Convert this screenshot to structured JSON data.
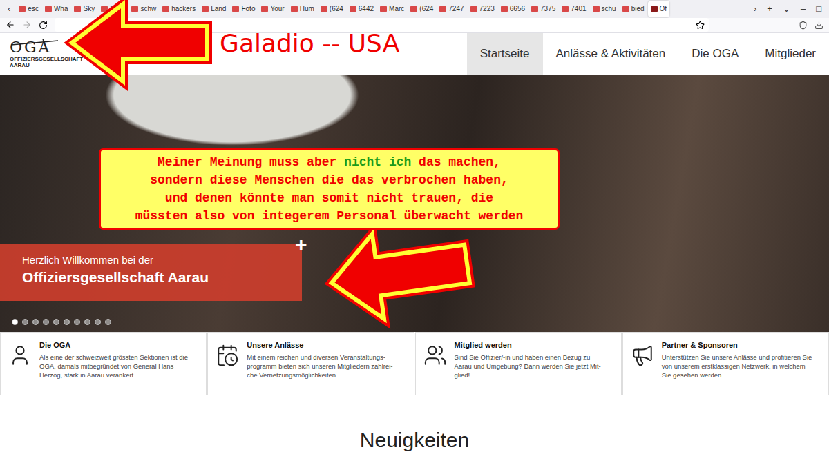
{
  "browser": {
    "scroll_left": "‹",
    "tabs": [
      {
        "label": "esc",
        "selected": false
      },
      {
        "label": "Wha",
        "selected": false
      },
      {
        "label": "Sky",
        "selected": false
      },
      {
        "label": "Marc",
        "selected": false
      },
      {
        "label": "schw",
        "selected": false
      },
      {
        "label": "hackers",
        "selected": false
      },
      {
        "label": "Land",
        "selected": false
      },
      {
        "label": "Foto",
        "selected": false
      },
      {
        "label": "Your",
        "selected": false
      },
      {
        "label": "Hum",
        "selected": false
      },
      {
        "label": "(624",
        "selected": false
      },
      {
        "label": "6442",
        "selected": false
      },
      {
        "label": "Marc",
        "selected": false
      },
      {
        "label": "(624",
        "selected": false
      },
      {
        "label": "7247",
        "selected": false
      },
      {
        "label": "7223",
        "selected": false
      },
      {
        "label": "6656",
        "selected": false
      },
      {
        "label": "7375",
        "selected": false
      },
      {
        "label": "7401",
        "selected": false
      },
      {
        "label": "schu",
        "selected": false
      },
      {
        "label": "bied",
        "selected": false
      },
      {
        "label": "Of",
        "selected": true
      }
    ],
    "controls": [
      "›",
      "+",
      "⌄",
      "–",
      "□"
    ]
  },
  "site": {
    "logo": {
      "mark": "OGA",
      "name_lines": [
        "OFFIZIERSGESELLSCHAFT",
        "AARAU"
      ]
    },
    "nav": [
      {
        "label": "Startseite",
        "selected": true
      },
      {
        "label": "Anlässe & Aktivitäten",
        "selected": false
      },
      {
        "label": "Die OGA",
        "selected": false
      },
      {
        "label": "Mitglieder",
        "selected": false
      }
    ]
  },
  "hero": {
    "banner_lines": [
      "Herzlich Willkommen bei der",
      "Offiziersgesellschaft Aarau"
    ],
    "plus": "+",
    "dots": [
      {
        "selected": true
      },
      {
        "selected": false
      },
      {
        "selected": false
      },
      {
        "selected": false
      },
      {
        "selected": false
      },
      {
        "selected": false
      },
      {
        "selected": false
      },
      {
        "selected": false
      },
      {
        "selected": false
      },
      {
        "selected": false
      }
    ]
  },
  "cards": [
    {
      "kind": "soldier",
      "title": "Die OGA",
      "lines": [
        "Als eine der schweizweit grössten Sektionen ist die",
        "OGA, damals mitbegründet von General Hans",
        "Herzog, stark in Aarau verankert."
      ]
    },
    {
      "kind": "calendar",
      "title": "Unsere Anlässe",
      "lines": [
        "Mit einem reichen und diversen Veranstaltungs-",
        "programm bieten sich unseren Mitgliedern zahlrei-",
        "che Vernetzungsmöglichkeiten."
      ]
    },
    {
      "kind": "members",
      "title": "Mitglied werden",
      "lines": [
        "Sind Sie Offizier/-in und haben einen Bezug zu",
        "Aarau und Umgebung? Dann werden Sie jetzt Mit-",
        "glied!"
      ]
    },
    {
      "kind": "megaphone",
      "title": "Partner & Sponsoren",
      "lines": [
        "Unterstützen Sie unsere Anlässe und profitieren Sie",
        "von unserem erstklassigen Netzwerk, in welchem",
        "Sie gesehen werden."
      ]
    }
  ],
  "news_heading": "Neuigkeiten",
  "annotations": {
    "label": "Galadio -- USA",
    "note_lines": [
      [
        {
          "text": "Meiner Meinung muss aber ",
          "highlight": false
        },
        {
          "text": "nicht ich",
          "highlight": true
        },
        {
          "text": " das machen,",
          "highlight": false
        }
      ],
      [
        {
          "text": "sondern diese Menschen die das verbrochen haben,",
          "highlight": false
        }
      ],
      [
        {
          "text": "und denen könnte man somit nicht trauen, die",
          "highlight": false
        }
      ],
      [
        {
          "text": "müssten also von integerem Personal überwacht werden",
          "highlight": false
        }
      ]
    ]
  }
}
